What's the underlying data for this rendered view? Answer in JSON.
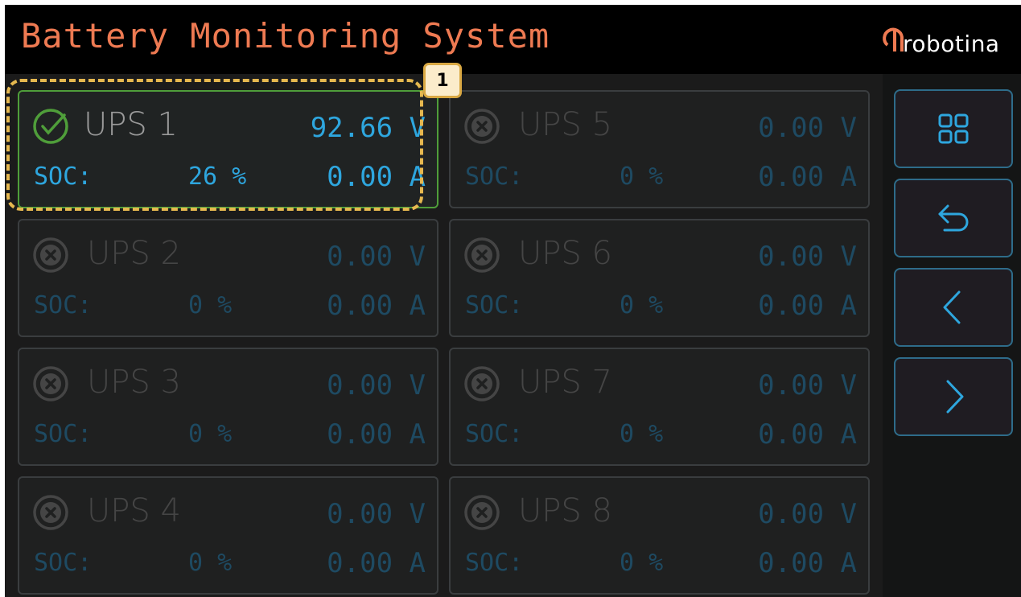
{
  "header": {
    "title": "Battery Monitoring System",
    "logo_text": "robotina"
  },
  "annotation": {
    "badge": "1"
  },
  "units": [
    {
      "status": "ok",
      "icon": "check-circle-icon",
      "name": "UPS 1",
      "voltage": "92.66 V",
      "soc_label": "SOC:",
      "soc": "26 %",
      "current": "0.00 A"
    },
    {
      "status": "fault",
      "icon": "x-circle-icon",
      "name": "UPS 2",
      "voltage": "0.00 V",
      "soc_label": "SOC:",
      "soc": "0 %",
      "current": "0.00 A"
    },
    {
      "status": "fault",
      "icon": "x-circle-icon",
      "name": "UPS 3",
      "voltage": "0.00 V",
      "soc_label": "SOC:",
      "soc": "0 %",
      "current": "0.00 A"
    },
    {
      "status": "fault",
      "icon": "x-circle-icon",
      "name": "UPS 4",
      "voltage": "0.00 V",
      "soc_label": "SOC:",
      "soc": "0 %",
      "current": "0.00 A"
    },
    {
      "status": "fault",
      "icon": "x-circle-icon",
      "name": "UPS 5",
      "voltage": "0.00 V",
      "soc_label": "SOC:",
      "soc": "0 %",
      "current": "0.00 A"
    },
    {
      "status": "fault",
      "icon": "x-circle-icon",
      "name": "UPS 6",
      "voltage": "0.00 V",
      "soc_label": "SOC:",
      "soc": "0 %",
      "current": "0.00 A"
    },
    {
      "status": "fault",
      "icon": "x-circle-icon",
      "name": "UPS 7",
      "voltage": "0.00 V",
      "soc_label": "SOC:",
      "soc": "0 %",
      "current": "0.00 A"
    },
    {
      "status": "fault",
      "icon": "x-circle-icon",
      "name": "UPS 8",
      "voltage": "0.00 V",
      "soc_label": "SOC:",
      "soc": "0 %",
      "current": "0.00 A"
    }
  ],
  "sidebar": {
    "buttons": [
      {
        "icon": "grid-icon"
      },
      {
        "icon": "undo-arrow-icon"
      },
      {
        "icon": "chevron-left-icon"
      },
      {
        "icon": "chevron-right-icon"
      }
    ]
  },
  "colors": {
    "title": "#ee7a52",
    "ok": "#4f9e3a",
    "value_active": "#2ea6de",
    "value_inactive": "#1e4a62",
    "highlight": "#e6b84f",
    "sidebar_border": "#2e6c8a"
  }
}
